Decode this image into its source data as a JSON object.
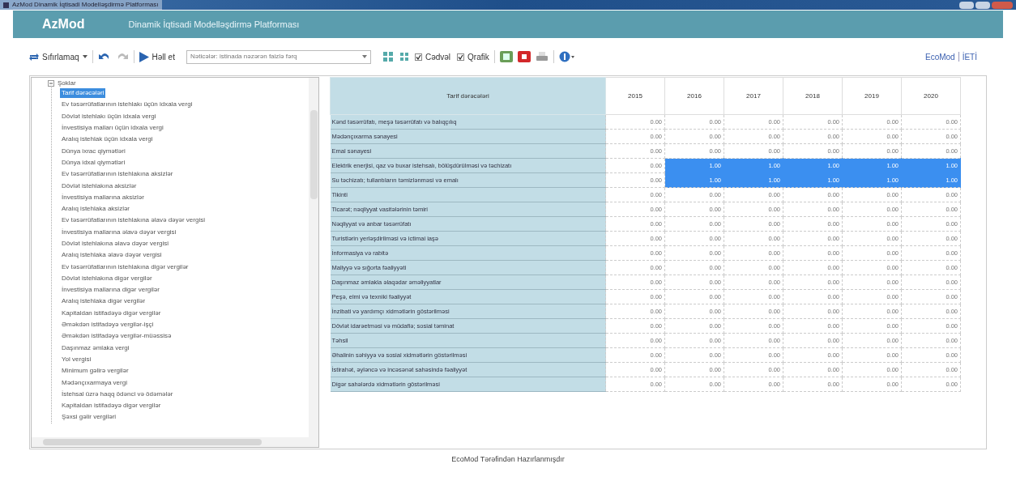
{
  "window": {
    "title": "AzMod Dinamik İqtisadi Modelləşdirmə Platforması"
  },
  "header": {
    "logo": "AzMod",
    "subtitle": "Dinamik İqtisadi Modelləşdirmə Platforması"
  },
  "toolbar": {
    "reset": "Sıfırlamaq",
    "solve": "Həll et",
    "results_select": "Nəticələr: istinada nəzərən faizlə fərq",
    "checkboxes": [
      {
        "label": "Cədvəl",
        "checked": true
      },
      {
        "label": "Qrafik",
        "checked": true
      }
    ],
    "links": [
      "EcoMod",
      "İETİ"
    ]
  },
  "tree": {
    "label": "Şoklar",
    "expanded": true,
    "children": [
      {
        "label": "Tarif dərəcələri",
        "selected": true
      },
      {
        "label": "Ev təsərrüfatlarının istehlakı üçün idxala vergi",
        "selected": false
      },
      {
        "label": "Dövlət istehlakı üçün idxala vergi",
        "selected": false
      },
      {
        "label": "İnvestisiya malları üçün idxala vergi",
        "selected": false
      },
      {
        "label": "Aralıq istehlak üçün idxala vergi",
        "selected": false
      },
      {
        "label": "Dünya ixrac qiymətləri",
        "selected": false
      },
      {
        "label": "Dünya idxal qiymətləri",
        "selected": false
      },
      {
        "label": "Ev təsərrüfatlarının istehlakına aksizlər",
        "selected": false
      },
      {
        "label": "Dövlət istehlakına aksizlər",
        "selected": false
      },
      {
        "label": "İnvestisiya mallarına aksizlər",
        "selected": false
      },
      {
        "label": "Aralıq istehlaka aksizlər",
        "selected": false
      },
      {
        "label": "Ev təsərrüfatlarının istehlakına əlavə dəyər vergisi",
        "selected": false
      },
      {
        "label": "İnvestisiya mallarına əlavə dəyər vergisi",
        "selected": false
      },
      {
        "label": "Dövlət istehlakına əlavə dəyər vergisi",
        "selected": false
      },
      {
        "label": "Aralıq istehlaka  əlavə dəyər vergisi",
        "selected": false
      },
      {
        "label": "Ev təsərrüfatlarının istehlakına digər vergilər",
        "selected": false
      },
      {
        "label": "Dövlət istehlakına digər vergilər",
        "selected": false
      },
      {
        "label": "İnvestisiya mallarına digər vergilər",
        "selected": false
      },
      {
        "label": "Aralıq istehlaka digər vergilər",
        "selected": false
      },
      {
        "label": "Kapitaldan istifadəyə digər vergilər",
        "selected": false
      },
      {
        "label": "Əməkdən istifadəyə vergilər-işçi",
        "selected": false
      },
      {
        "label": "Əməkdən istifadəyə vergilər-müəssisə",
        "selected": false
      },
      {
        "label": "Daşınmaz əmlaka vergi",
        "selected": false
      },
      {
        "label": "Yol vergisi",
        "selected": false
      },
      {
        "label": "Minimum gəlirə vergilər",
        "selected": false
      },
      {
        "label": "Mədənçıxarmaya vergi",
        "selected": false
      },
      {
        "label": "İstehsal üzrə haqq ödənci və ödəmələr",
        "selected": false
      },
      {
        "label": "Kapitaldan istifadəyə digər vergilər",
        "selected": false
      },
      {
        "label": "Şəxsi gəlir vergiləri",
        "selected": false
      }
    ]
  },
  "table": {
    "columns": [
      "Tarif dərəcələri",
      "2015",
      "2016",
      "2017",
      "2018",
      "2019",
      "2020"
    ],
    "rows": [
      {
        "cells": [
          "Kənd təsərrüfatı, meşə təsərrüfatı və balıqçılıq",
          "0.00",
          "0.00",
          "0.00",
          "0.00",
          "0.00",
          "0.00"
        ],
        "selected": [
          false,
          false,
          false,
          false,
          false,
          false
        ]
      },
      {
        "cells": [
          "Mədənçıxarma sənayesi",
          "0.00",
          "0.00",
          "0.00",
          "0.00",
          "0.00",
          "0.00"
        ],
        "selected": [
          false,
          false,
          false,
          false,
          false,
          false
        ]
      },
      {
        "cells": [
          "Emal sənayesi",
          "0.00",
          "0.00",
          "0.00",
          "0.00",
          "0.00",
          "0.00"
        ],
        "selected": [
          false,
          false,
          false,
          false,
          false,
          false
        ]
      },
      {
        "cells": [
          "Elektrik enerjisi, qaz və buxar istehsalı, bölüşdürülməsi və təchizatı",
          "0.00",
          "1.00",
          "1.00",
          "1.00",
          "1.00",
          "1.00"
        ],
        "selected": [
          false,
          true,
          true,
          true,
          true,
          true
        ]
      },
      {
        "cells": [
          "Su təchizatı; tullantıların təmizlənməsi və emalı",
          "0.00",
          "1.00",
          "1.00",
          "1.00",
          "1.00",
          "1.00"
        ],
        "selected": [
          false,
          true,
          true,
          true,
          true,
          true
        ]
      },
      {
        "cells": [
          "Tikinti",
          "0.00",
          "0.00",
          "0.00",
          "0.00",
          "0.00",
          "0.00"
        ],
        "selected": [
          false,
          false,
          false,
          false,
          false,
          false
        ]
      },
      {
        "cells": [
          "Ticarət; nəqliyyat vasitələrinin təmiri",
          "0.00",
          "0.00",
          "0.00",
          "0.00",
          "0.00",
          "0.00"
        ],
        "selected": [
          false,
          false,
          false,
          false,
          false,
          false
        ]
      },
      {
        "cells": [
          "Nəqliyyat və anbar təsərrüfatı",
          "0.00",
          "0.00",
          "0.00",
          "0.00",
          "0.00",
          "0.00"
        ],
        "selected": [
          false,
          false,
          false,
          false,
          false,
          false
        ]
      },
      {
        "cells": [
          "Turistlərin yerləşdirilməsi və ictimai iaşə",
          "0.00",
          "0.00",
          "0.00",
          "0.00",
          "0.00",
          "0.00"
        ],
        "selected": [
          false,
          false,
          false,
          false,
          false,
          false
        ]
      },
      {
        "cells": [
          "İnformasiya və rabitə",
          "0.00",
          "0.00",
          "0.00",
          "0.00",
          "0.00",
          "0.00"
        ],
        "selected": [
          false,
          false,
          false,
          false,
          false,
          false
        ]
      },
      {
        "cells": [
          "Maliyyə və sığorta fəaliyyəti",
          "0.00",
          "0.00",
          "0.00",
          "0.00",
          "0.00",
          "0.00"
        ],
        "selected": [
          false,
          false,
          false,
          false,
          false,
          false
        ]
      },
      {
        "cells": [
          "Daşınmaz əmlakla əlaqədar əməliyyatlar",
          "0.00",
          "0.00",
          "0.00",
          "0.00",
          "0.00",
          "0.00"
        ],
        "selected": [
          false,
          false,
          false,
          false,
          false,
          false
        ]
      },
      {
        "cells": [
          "Peşə, elmi və texniki fəaliyyət",
          "0.00",
          "0.00",
          "0.00",
          "0.00",
          "0.00",
          "0.00"
        ],
        "selected": [
          false,
          false,
          false,
          false,
          false,
          false
        ]
      },
      {
        "cells": [
          "İnzibati və yardımçı xidmətlərin göstərilməsi",
          "0.00",
          "0.00",
          "0.00",
          "0.00",
          "0.00",
          "0.00"
        ],
        "selected": [
          false,
          false,
          false,
          false,
          false,
          false
        ]
      },
      {
        "cells": [
          "Dövlət idarəetməsi və müdafiə; sosial təminat",
          "0.00",
          "0.00",
          "0.00",
          "0.00",
          "0.00",
          "0.00"
        ],
        "selected": [
          false,
          false,
          false,
          false,
          false,
          false
        ]
      },
      {
        "cells": [
          "Təhsil",
          "0.00",
          "0.00",
          "0.00",
          "0.00",
          "0.00",
          "0.00"
        ],
        "selected": [
          false,
          false,
          false,
          false,
          false,
          false
        ]
      },
      {
        "cells": [
          "Əhalinin səhiyyə və sosial xidmətlərin göstərilməsi",
          "0.00",
          "0.00",
          "0.00",
          "0.00",
          "0.00",
          "0.00"
        ],
        "selected": [
          false,
          false,
          false,
          false,
          false,
          false
        ]
      },
      {
        "cells": [
          "İstirahət, əyləncə və incəsənət sahəsində fəaliyyət",
          "0.00",
          "0.00",
          "0.00",
          "0.00",
          "0.00",
          "0.00"
        ],
        "selected": [
          false,
          false,
          false,
          false,
          false,
          false
        ]
      },
      {
        "cells": [
          "Digər sahələrdə xidmətlərin göstərilməsi",
          "0.00",
          "0.00",
          "0.00",
          "0.00",
          "0.00",
          "0.00"
        ],
        "selected": [
          false,
          false,
          false,
          false,
          false,
          false
        ]
      }
    ]
  },
  "footer": "EcoMod Tərəfindən Hazırlanmışdır"
}
